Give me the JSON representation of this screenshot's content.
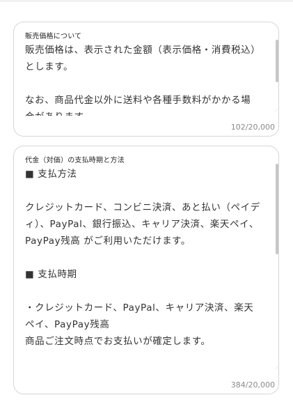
{
  "fields": {
    "sales_price": {
      "label": "販売価格について",
      "value": "販売価格は、表示された金額（表示価格・消費税込）とします。\n\nなお、商品代金以外に送料や各種手数料がかかる場合があります。",
      "counter": "102/20,000"
    },
    "payment": {
      "label": "代金（対価）の支払時期と方法",
      "value": "■ 支払方法\n\nクレジットカード、コンビニ決済、あと払い（ペイディ）、PayPal、銀行振込、キャリア決済、楽天ペイ、PayPay残高 がご利用いただけます。\n\n■ 支払時期\n\n・クレジットカード、PayPal、キャリア決済、楽天ペイ、PayPay残高\n商品ご注文時点でお支払いが確定します。",
      "counter": "384/20,000"
    }
  }
}
